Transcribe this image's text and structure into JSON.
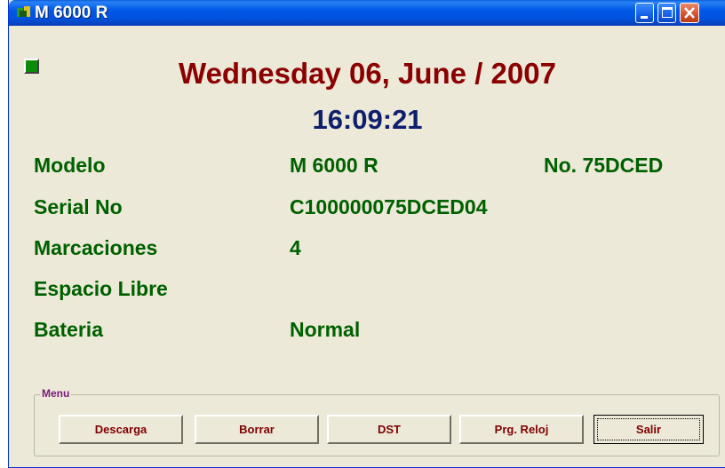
{
  "window": {
    "title": "M 6000 R",
    "accent": "#0058e6",
    "close_color": "#d4502a"
  },
  "header": {
    "date": "Wednesday 06, June / 2007",
    "time": "16:09:21",
    "date_color": "#8b0000",
    "time_color": "#0d1f6e",
    "status_led_color": "#0c8a0c"
  },
  "info": {
    "modelo_label": "Modelo",
    "modelo_value": "M 6000 R",
    "modelo_number": "No. 75DCED",
    "serial_label": "Serial No",
    "serial_value": "C100000075DCED04",
    "marcaciones_label": "Marcaciones",
    "marcaciones_value": "4",
    "espacio_label": "Espacio Libre",
    "bateria_label": "Bateria",
    "bateria_value": "Normal",
    "text_color": "#006000"
  },
  "menu": {
    "legend": "Menu",
    "buttons": {
      "descarga": "Descarga",
      "borrar": "Borrar",
      "dst": "DST",
      "prg_reloj": "Prg. Reloj",
      "salir": "Salir"
    }
  },
  "icons": {
    "app": "app-logo-icon",
    "minimize": "minimize-icon",
    "maximize": "maximize-icon",
    "close": "close-icon",
    "status": "status-led-icon"
  }
}
